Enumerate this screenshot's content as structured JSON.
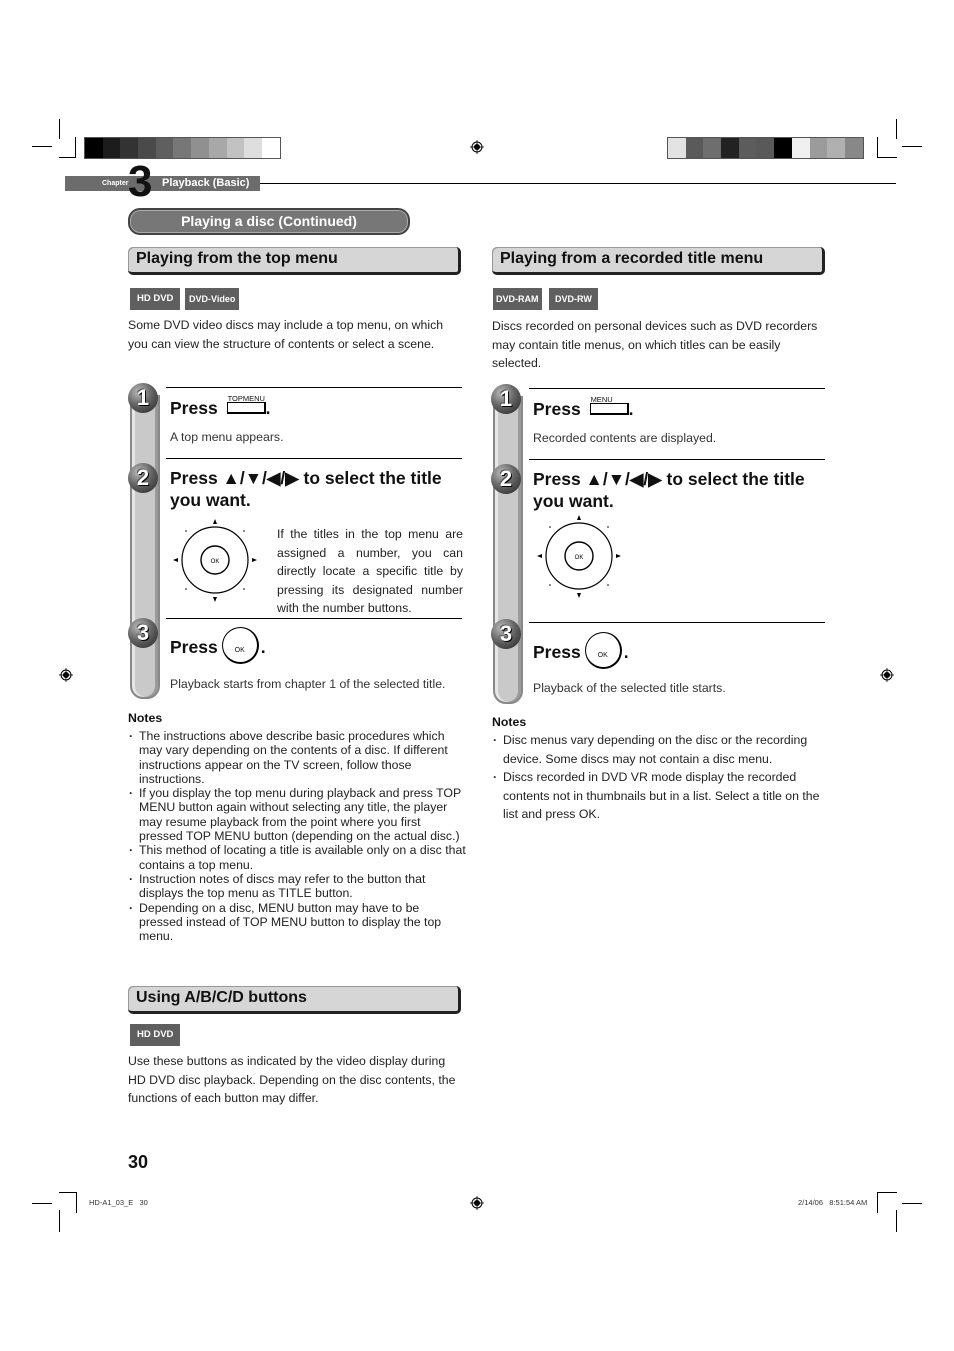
{
  "header": {
    "chapter_word": "Chapter",
    "chapter_number": "3",
    "chapter_title": "Playback (Basic)",
    "section_pill": "Playing a disc (Continued)"
  },
  "color_bars": {
    "left": [
      "#000000",
      "#1c1c1c",
      "#333333",
      "#4a4a4a",
      "#5f5f5f",
      "#777777",
      "#909090",
      "#a8a8a8",
      "#c2c2c2",
      "#dedede",
      "#ffffff"
    ],
    "right": [
      "#e3e3e3",
      "#5a5a5a",
      "#6e6e6e",
      "#222222",
      "#5c5c5c",
      "#595959",
      "#000000",
      "#f0f0f0",
      "#9b9b9b",
      "#b0b0b0",
      "#888888"
    ]
  },
  "left": {
    "section1": {
      "title": "Playing from the top menu",
      "tags": [
        "HD DVD",
        "DVD-Video"
      ],
      "intro": "Some DVD video discs may include a top menu, on which you can view the structure of contents or select a scene.",
      "steps": [
        {
          "number": "1",
          "title_prefix": "Press",
          "button_label": "TOPMENU",
          "title_suffix": ".",
          "desc": "A top menu appears."
        },
        {
          "number": "2",
          "title": "Press ▲/▼/◀/▶ to select the title you want.",
          "desc": "If the titles in the top menu are assigned a number, you can directly locate a specific title by pressing its designated number with the number buttons.",
          "dpad_label": "OK"
        },
        {
          "number": "3",
          "title_prefix": "Press",
          "button_label": "OK",
          "title_suffix": ".",
          "desc": "Playback starts from chapter 1 of the selected title."
        }
      ],
      "notes_heading": "Notes",
      "notes": [
        "The instructions above describe basic procedures which may vary depending on the contents of a disc. If different instructions appear on the TV screen, follow those instructions.",
        "If you display the top menu during playback and press TOP MENU button again without selecting any title, the player may resume playback from the point where you first pressed TOP MENU button (depending on the actual disc.)",
        "This method of locating a title is available only on a disc that contains a top menu.",
        "Instruction notes of discs may refer to the button that displays the top menu as TITLE button.",
        "Depending on a disc, MENU button may have to be pressed instead of TOP MENU button to display the top menu."
      ]
    },
    "section2": {
      "title": "Using A/B/C/D buttons",
      "tags": [
        "HD DVD"
      ],
      "intro": "Use these buttons as indicated by the video display during HD DVD disc playback. Depending on the disc contents, the functions of each button may differ."
    }
  },
  "right": {
    "section1": {
      "title": "Playing from a recorded title menu",
      "tags": [
        "DVD-RAM",
        "DVD-RW"
      ],
      "intro": "Discs recorded on personal devices such as DVD recorders may contain title menus, on which titles can be easily selected.",
      "steps": [
        {
          "number": "1",
          "title_prefix": "Press",
          "button_label": "MENU",
          "title_suffix": ".",
          "desc": "Recorded contents are displayed."
        },
        {
          "number": "2",
          "title": "Press ▲/▼/◀/▶ to select the title you want.",
          "dpad_label": "OK"
        },
        {
          "number": "3",
          "title_prefix": "Press",
          "button_label": "OK",
          "title_suffix": ".",
          "desc": "Playback of the selected title starts."
        }
      ],
      "notes_heading": "Notes",
      "notes": [
        "Disc menus vary depending on the disc or the recording device. Some discs may not contain a disc menu.",
        "Discs recorded in DVD VR mode display the recorded contents not in thumbnails but in a list. Select a title on the list and press OK."
      ]
    }
  },
  "footer": {
    "page_number": "30",
    "file_info": "HD-A1_03_E   30",
    "timestamp": "2/14/06   8:51:54 AM"
  }
}
